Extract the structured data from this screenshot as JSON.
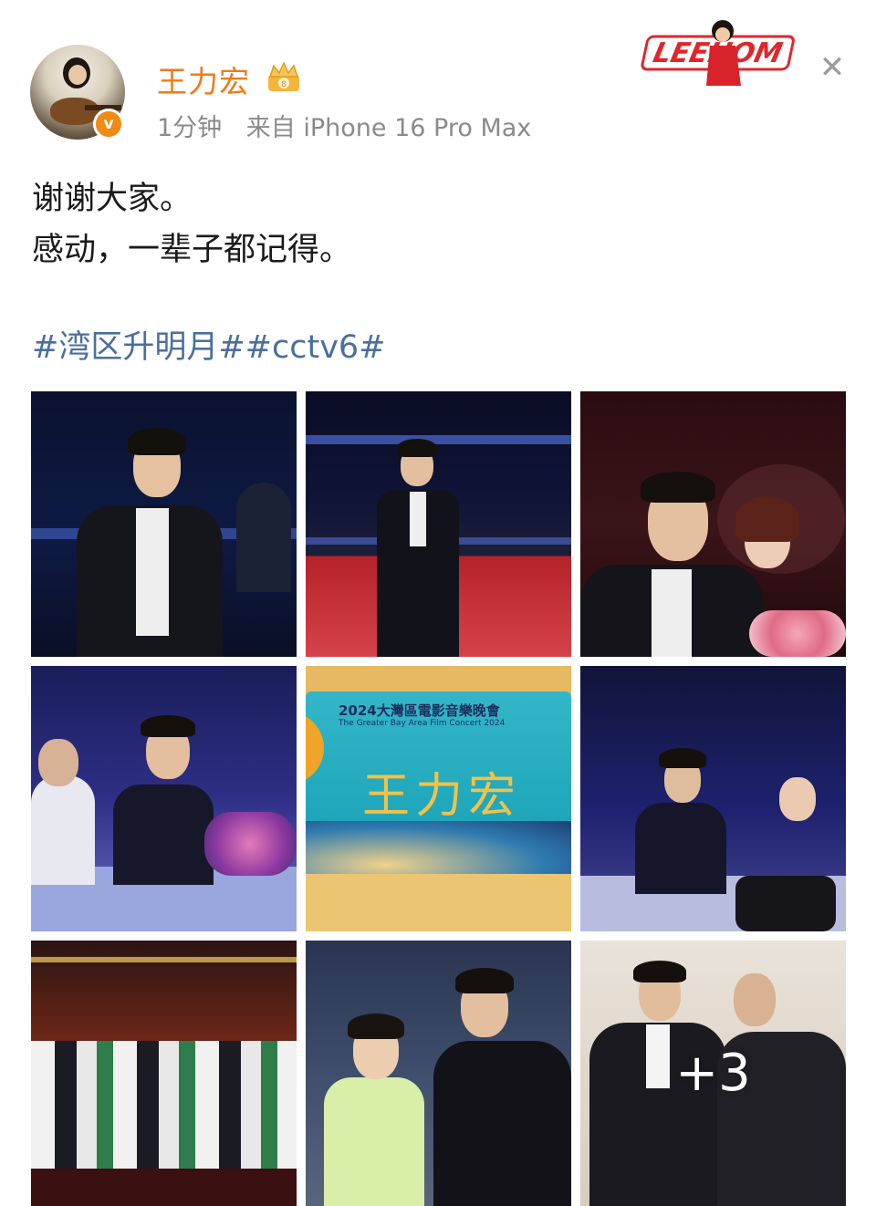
{
  "post": {
    "username": "王力宏",
    "time": "1分钟",
    "source": "来自 iPhone 16 Pro Max",
    "verified_icon": "v",
    "lines": [
      "谢谢大家。",
      "感动，一辈子都记得。"
    ],
    "tags": "#湾区升明月##cctv6#"
  },
  "sticker": {
    "text": "LEEHOM"
  },
  "gallery": {
    "extra_count": "+3",
    "banner": {
      "title_cn": "2024大灣區電影音樂晚會",
      "title_en": "The Greater Bay Area Film Concert 2024",
      "name": "王力宏"
    }
  },
  "colors": {
    "username": "#f07a16",
    "tag_link": "#4a6f9e",
    "meta": "#8a8a8a",
    "verified_badge": "#f08a13"
  },
  "icons": {
    "close": "close-icon",
    "crown": "crown-badge-icon",
    "verified": "verified-badge-icon"
  }
}
